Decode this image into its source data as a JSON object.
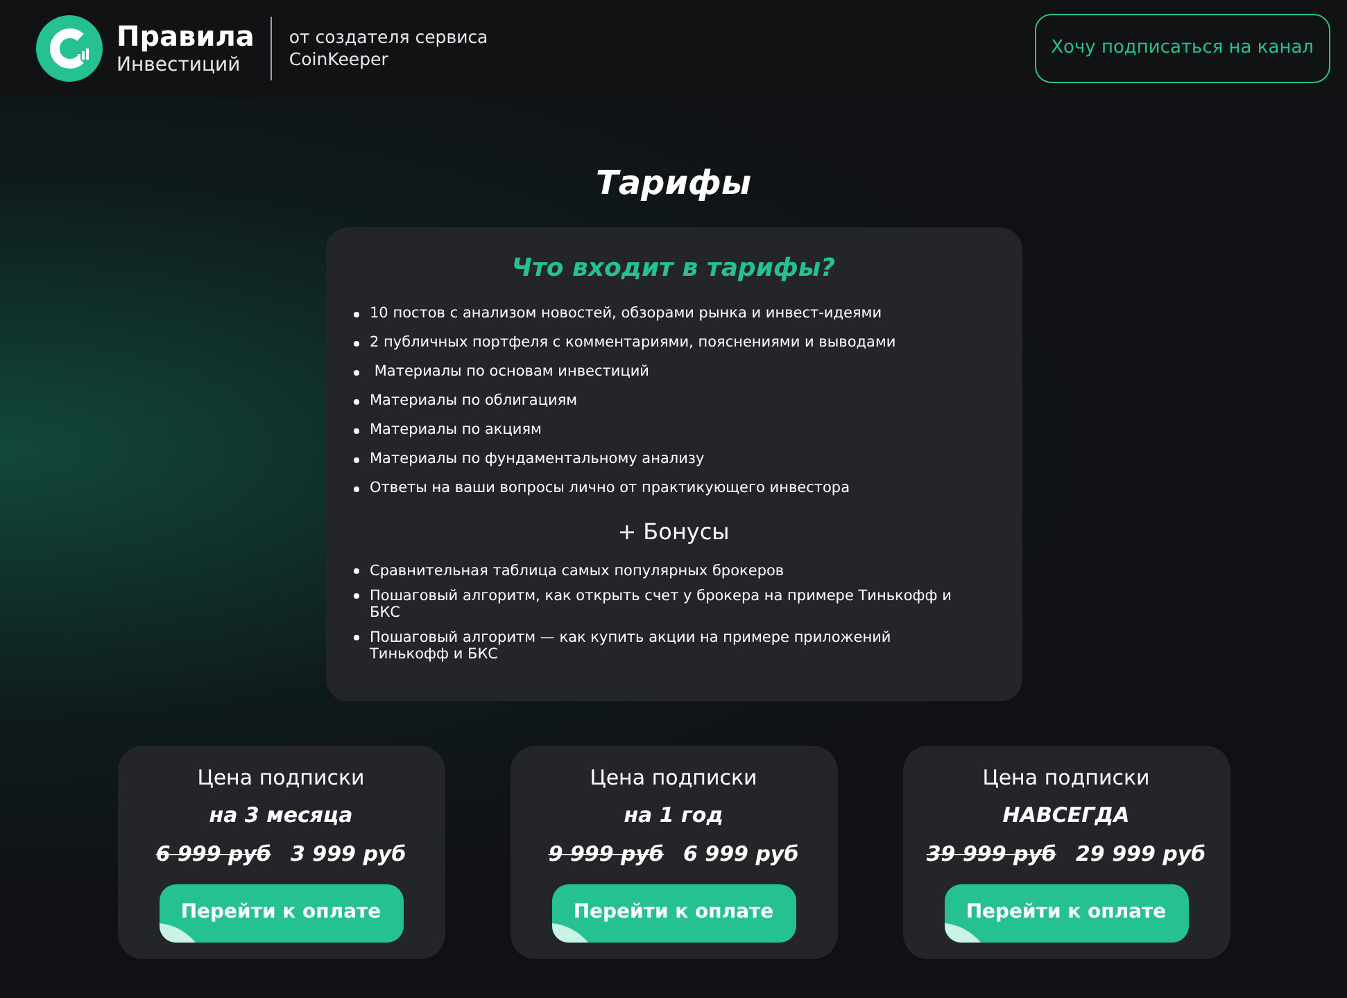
{
  "header": {
    "logo_title": "Правила",
    "logo_subtitle": "Инвестиций",
    "tagline_line1": "от создателя сервиса",
    "tagline_line2": "CoinKeeper",
    "subscribe_button": "Хочу подписаться на канал"
  },
  "page_title": "Тарифы",
  "features_card": {
    "heading": "Что входит в тарифы?",
    "items": [
      "10 постов с анализом новостей, обзорами рынка и инвест-идеями",
      "2 публичных портфеля с комментариями, пояснениями и выводами",
      " Материалы по основам инвестиций",
      "Материалы по облигациям",
      "Материалы по акциям",
      "Материалы по фундаментальному анализу",
      "Ответы на ваши вопросы лично от практикующего инвестора"
    ],
    "bonus_heading": "+ Бонусы",
    "bonus_items": [
      "Сравнительная таблица самых популярных брокеров",
      "Пошаговый алгоритм, как открыть счет у брокера на примере Тинькофф и БКС",
      "Пошаговый алгоритм — как купить акции на примере приложений Тинькофф и БКС"
    ]
  },
  "plans": [
    {
      "title": "Цена подписки",
      "period": "на 3 месяца",
      "old_price": "6 999 руб",
      "price": "3 999 руб",
      "button": "Перейти к оплате"
    },
    {
      "title": "Цена подписки",
      "period": "на 1 год",
      "old_price": "9 999 руб",
      "price": "6 999 руб",
      "button": "Перейти к оплате"
    },
    {
      "title": "Цена подписки",
      "period": "НАВСЕГДА",
      "old_price": "39 999 руб",
      "price": "29 999 руб",
      "button": "Перейти к оплате"
    }
  ]
}
